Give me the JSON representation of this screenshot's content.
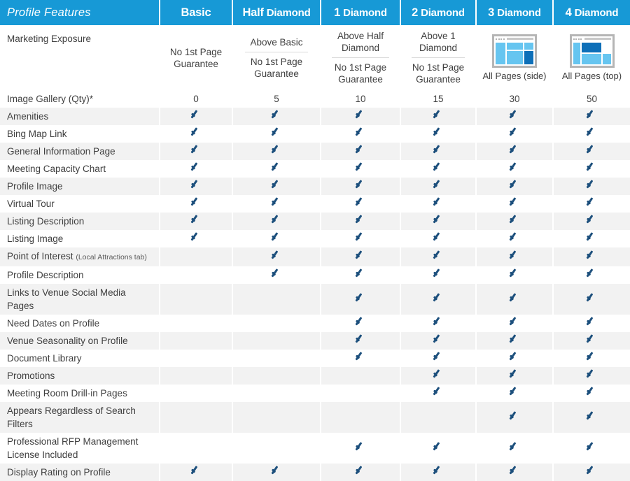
{
  "table": {
    "title_column": "Profile Features",
    "columns": [
      {
        "id": "basic",
        "label": "Basic",
        "lead": "",
        "rest": "Basic"
      },
      {
        "id": "half_diamond",
        "label": "Half Diamond",
        "lead": "Half",
        "rest": "Diamond"
      },
      {
        "id": "1_diamond",
        "label": "1 Diamond",
        "lead": "1",
        "rest": "Diamond"
      },
      {
        "id": "2_diamond",
        "label": "2 Diamond",
        "lead": "2",
        "rest": "Diamond"
      },
      {
        "id": "3_diamond",
        "label": "3 Diamond",
        "lead": "3",
        "rest": "Diamond"
      },
      {
        "id": "4_diamond",
        "label": "4 Diamond",
        "lead": "4",
        "rest": "Diamond"
      }
    ],
    "marketing_exposure": {
      "feature": "Marketing Exposure",
      "cells": [
        {
          "type": "text",
          "lines": [
            "No 1st Page",
            "Guarantee"
          ]
        },
        {
          "type": "split",
          "top": [
            "Above Basic"
          ],
          "bottom": [
            "No 1st Page",
            "Guarantee"
          ]
        },
        {
          "type": "split",
          "top": [
            "Above Half",
            "Diamond"
          ],
          "bottom": [
            "No 1st Page",
            "Guarantee"
          ]
        },
        {
          "type": "split",
          "top": [
            "Above 1",
            "Diamond"
          ],
          "bottom": [
            "No 1st Page",
            "Guarantee"
          ]
        },
        {
          "type": "icon",
          "icon": "browser-side-layout-icon",
          "caption": "All Pages (side)"
        },
        {
          "type": "icon",
          "icon": "browser-top-layout-icon",
          "caption": "All Pages (top)"
        }
      ]
    },
    "image_gallery": {
      "feature": "Image Gallery (Qty)*",
      "values": [
        "0",
        "5",
        "10",
        "15",
        "30",
        "50"
      ]
    },
    "rows": [
      {
        "feature": "Amenities",
        "note": "",
        "lines": 1,
        "checks": [
          true,
          true,
          true,
          true,
          true,
          true
        ]
      },
      {
        "feature": "Bing Map Link",
        "note": "",
        "lines": 1,
        "checks": [
          true,
          true,
          true,
          true,
          true,
          true
        ]
      },
      {
        "feature": "General Information Page",
        "note": "",
        "lines": 1,
        "checks": [
          true,
          true,
          true,
          true,
          true,
          true
        ]
      },
      {
        "feature": "Meeting Capacity Chart",
        "note": "",
        "lines": 1,
        "checks": [
          true,
          true,
          true,
          true,
          true,
          true
        ]
      },
      {
        "feature": "Profile Image",
        "note": "",
        "lines": 1,
        "checks": [
          true,
          true,
          true,
          true,
          true,
          true
        ]
      },
      {
        "feature": "Virtual Tour",
        "note": "",
        "lines": 1,
        "checks": [
          true,
          true,
          true,
          true,
          true,
          true
        ]
      },
      {
        "feature": "Listing Description",
        "note": "",
        "lines": 1,
        "checks": [
          true,
          true,
          true,
          true,
          true,
          true
        ]
      },
      {
        "feature": "Listing Image",
        "note": "",
        "lines": 1,
        "checks": [
          true,
          true,
          true,
          true,
          true,
          true
        ]
      },
      {
        "feature": "Point of Interest",
        "note": "(Local Attractions tab)",
        "lines": 1,
        "checks": [
          false,
          true,
          true,
          true,
          true,
          true
        ]
      },
      {
        "feature": "Profile Description",
        "note": "",
        "lines": 1,
        "checks": [
          false,
          true,
          true,
          true,
          true,
          true
        ]
      },
      {
        "feature": "Links to Venue Social Media Pages",
        "note": "",
        "lines": 2,
        "checks": [
          false,
          false,
          true,
          true,
          true,
          true
        ]
      },
      {
        "feature": "Need Dates on Profile",
        "note": "",
        "lines": 1,
        "checks": [
          false,
          false,
          true,
          true,
          true,
          true
        ]
      },
      {
        "feature": "Venue Seasonality on Profile",
        "note": "",
        "lines": 1,
        "checks": [
          false,
          false,
          true,
          true,
          true,
          true
        ]
      },
      {
        "feature": "Document Library",
        "note": "",
        "lines": 1,
        "checks": [
          false,
          false,
          true,
          true,
          true,
          true
        ]
      },
      {
        "feature": "Promotions",
        "note": "",
        "lines": 1,
        "checks": [
          false,
          false,
          false,
          true,
          true,
          true
        ]
      },
      {
        "feature": "Meeting Room Drill-in Pages",
        "note": "",
        "lines": 1,
        "checks": [
          false,
          false,
          false,
          true,
          true,
          true
        ]
      },
      {
        "feature": "Appears Regardless of Search Filters",
        "note": "",
        "lines": 2,
        "checks": [
          false,
          false,
          false,
          false,
          true,
          true
        ]
      },
      {
        "feature": "Professional RFP Management License Included",
        "note": "",
        "lines": 2,
        "checks": [
          false,
          false,
          true,
          true,
          true,
          true
        ]
      },
      {
        "feature": "Display Rating on Profile",
        "note": "",
        "lines": 1,
        "checks": [
          true,
          true,
          true,
          true,
          true,
          true
        ]
      }
    ]
  },
  "colors": {
    "header_blue": "#1799d6",
    "check_navy": "#1c4f7c",
    "row_alt": "#f2f2f2",
    "row_plain": "#ffffff",
    "icon_light_blue": "#66c5f0",
    "icon_dark_blue": "#0d6fb8",
    "icon_frame_gray": "#b5b5b5"
  }
}
